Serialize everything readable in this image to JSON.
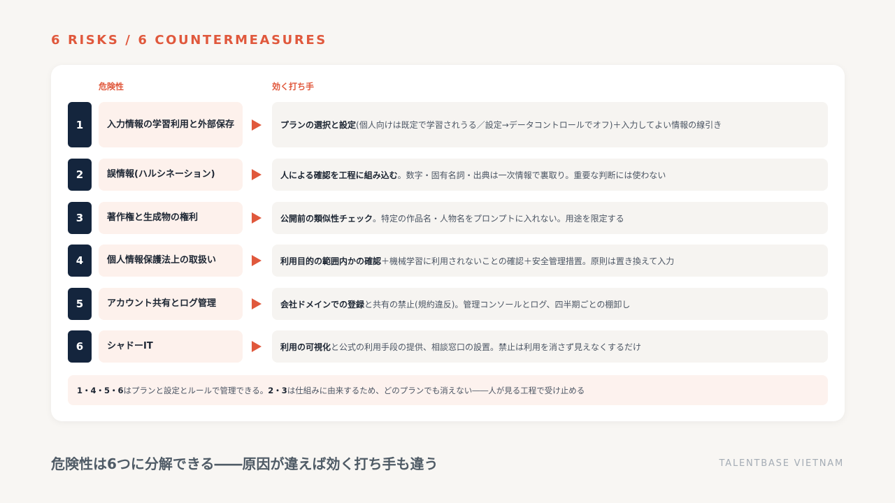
{
  "eyebrow": "6 RISKS / 6 COUNTERMEASURES",
  "columns": {
    "risk": "危険性",
    "measure": "効く打ち手"
  },
  "rows": [
    {
      "number": "1",
      "risk": "入力情報の学習利用と外部保存",
      "measure_bold": "プランの選択と設定",
      "measure_rest": "(個人向けは既定で学習されうる／設定→データコントロールでオフ)＋入力してよい情報の線引き"
    },
    {
      "number": "2",
      "risk": "誤情報(ハルシネーション)",
      "measure_bold": "人による確認を工程に組み込む",
      "measure_rest": "。数字・固有名詞・出典は一次情報で裏取り。重要な判断には使わない"
    },
    {
      "number": "3",
      "risk": "著作権と生成物の権利",
      "measure_bold": "公開前の類似性チェック",
      "measure_rest": "。特定の作品名・人物名をプロンプトに入れない。用途を限定する"
    },
    {
      "number": "4",
      "risk": "個人情報保護法上の取扱い",
      "measure_bold": "利用目的の範囲内かの確認",
      "measure_rest": "＋機械学習に利用されないことの確認＋安全管理措置。原則は置き換えて入力"
    },
    {
      "number": "5",
      "risk": "アカウント共有とログ管理",
      "measure_bold": "会社ドメインでの登録",
      "measure_rest": "と共有の禁止(規約違反)。管理コンソールとログ、四半期ごとの棚卸し"
    },
    {
      "number": "6",
      "risk": "シャドーIT",
      "measure_bold": "利用の可視化",
      "measure_rest": "と公式の利用手段の提供、相談窓口の設置。禁止は利用を消さず見えなくするだけ"
    }
  ],
  "note": {
    "bold_1": "1・4・5・6",
    "text_1": " はプランと設定とルールで管理できる。",
    "bold_2": "2・3",
    "text_2": " は仕組みに由来するため、どのプランでも消えない――人が見る工程で受け止める"
  },
  "headline": "危険性は6つに分解できる――原因が違えば効く打ち手も違う",
  "brand": "TALENTBASE VIETNAM"
}
